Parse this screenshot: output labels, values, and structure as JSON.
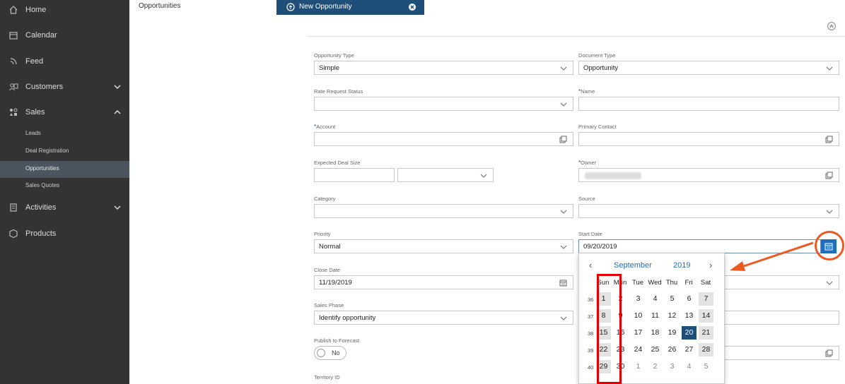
{
  "sidebar": {
    "items": [
      {
        "label": "Home",
        "icon": "home-icon"
      },
      {
        "label": "Calendar",
        "icon": "calendar-icon"
      },
      {
        "label": "Feed",
        "icon": "feed-icon"
      },
      {
        "label": "Customers",
        "icon": "customers-icon"
      },
      {
        "label": "Sales",
        "icon": "sales-icon"
      },
      {
        "label": "Activities",
        "icon": "activities-icon"
      },
      {
        "label": "Products",
        "icon": "products-icon"
      }
    ],
    "sales_sub": [
      {
        "label": "Leads"
      },
      {
        "label": "Deal Registration"
      },
      {
        "label": "Opportunities"
      },
      {
        "label": "Sales Quotes"
      }
    ]
  },
  "tabs": {
    "opportunities": "Opportunities",
    "new_opportunity": "New Opportunity"
  },
  "form": {
    "opportunity_type": {
      "label": "Opportunity Type",
      "value": "Simple"
    },
    "document_type": {
      "label": "Document Type",
      "value": "Opportunity"
    },
    "rate_request_status": {
      "label": "Rate Request Status",
      "value": ""
    },
    "name": {
      "label": "Name",
      "value": ""
    },
    "account": {
      "label": "Account",
      "value": ""
    },
    "primary_contact": {
      "label": "Primary Contact",
      "value": ""
    },
    "expected_deal_size": {
      "label": "Expected Deal Size",
      "value": ""
    },
    "owner": {
      "label": "Owner",
      "value": ""
    },
    "category": {
      "label": "Category",
      "value": ""
    },
    "source": {
      "label": "Source",
      "value": ""
    },
    "priority": {
      "label": "Priority",
      "value": "Normal"
    },
    "start_date": {
      "label": "Start Date",
      "value": "09/20/2019"
    },
    "close_date": {
      "label": "Close Date",
      "value": "11/19/2019"
    },
    "sales_phase": {
      "label": "Sales Phase",
      "value": "Identify opportunity"
    },
    "publish_to_forecast": {
      "label": "Publish to Forecast",
      "value": "No"
    },
    "territory_id": {
      "label": "Territory ID",
      "value": ""
    },
    "required_mark": "*"
  },
  "datepicker": {
    "month": "September",
    "year": "2019",
    "prev": "‹",
    "next": "›",
    "weekdays": [
      "Sun",
      "Mon",
      "Tue",
      "Wed",
      "Thu",
      "Fri",
      "Sat"
    ],
    "weeks": [
      {
        "num": "36",
        "days": [
          "1",
          "2",
          "3",
          "4",
          "5",
          "6",
          "7"
        ]
      },
      {
        "num": "37",
        "days": [
          "8",
          "9",
          "10",
          "11",
          "12",
          "13",
          "14"
        ]
      },
      {
        "num": "38",
        "days": [
          "15",
          "16",
          "17",
          "18",
          "19",
          "20",
          "21"
        ]
      },
      {
        "num": "39",
        "days": [
          "22",
          "23",
          "24",
          "25",
          "26",
          "27",
          "28"
        ]
      },
      {
        "num": "40",
        "days": [
          "29",
          "30",
          "1",
          "2",
          "3",
          "4",
          "5"
        ]
      }
    ],
    "selected_day": "20"
  },
  "colors": {
    "sidebar_bg": "#333333",
    "tab_active": "#1f4e79",
    "accent_blue": "#1f6fbf",
    "highlight_red": "#e40000",
    "annotation_orange": "#ec5a22"
  }
}
